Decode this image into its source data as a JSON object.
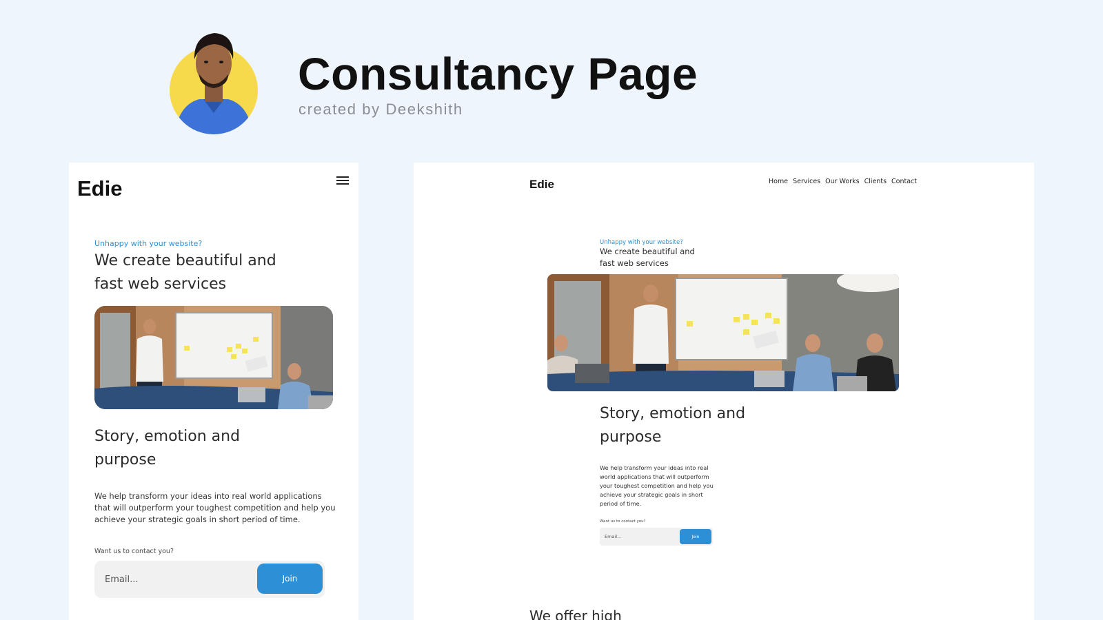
{
  "header": {
    "title": "Consultancy Page",
    "subtitle": "created by Deekshith",
    "avatar_bg": "#f7d94c",
    "avatar_shirt": "#3d72d8"
  },
  "colors": {
    "background": "#eef5fd",
    "card": "#ffffff",
    "accent": "#2d8fd5",
    "input_bg": "#f1f1f1"
  },
  "mobile": {
    "logo": "Edie",
    "menu_icon": "hamburger-menu-icon",
    "tagline": "Unhappy with your website?",
    "headline": "We create beautiful and fast web services",
    "section_title": "Story, emotion and purpose",
    "paragraph": "We help transform your ideas into real world applications that will outperform your toughest competition and help you achieve your strategic goals in short period of time.",
    "contact_prompt": "Want us to contact you?",
    "email_placeholder": "Email...",
    "join_label": "Join"
  },
  "desktop": {
    "logo": "Edie",
    "nav": [
      "Home",
      "Services",
      "Our Works",
      "Clients",
      "Contact"
    ],
    "tagline": "Unhappy with your website?",
    "headline": "We create beautiful and fast web services",
    "section_title": "Story, emotion and purpose",
    "paragraph": "We help transform your ideas into real world applications that will outperform your toughest competition and help you achieve your strategic goals in short period of time.",
    "contact_prompt": "Want us to contact you?",
    "email_placeholder": "Email...",
    "join_label": "Join",
    "next_section_title": "We offer high"
  }
}
